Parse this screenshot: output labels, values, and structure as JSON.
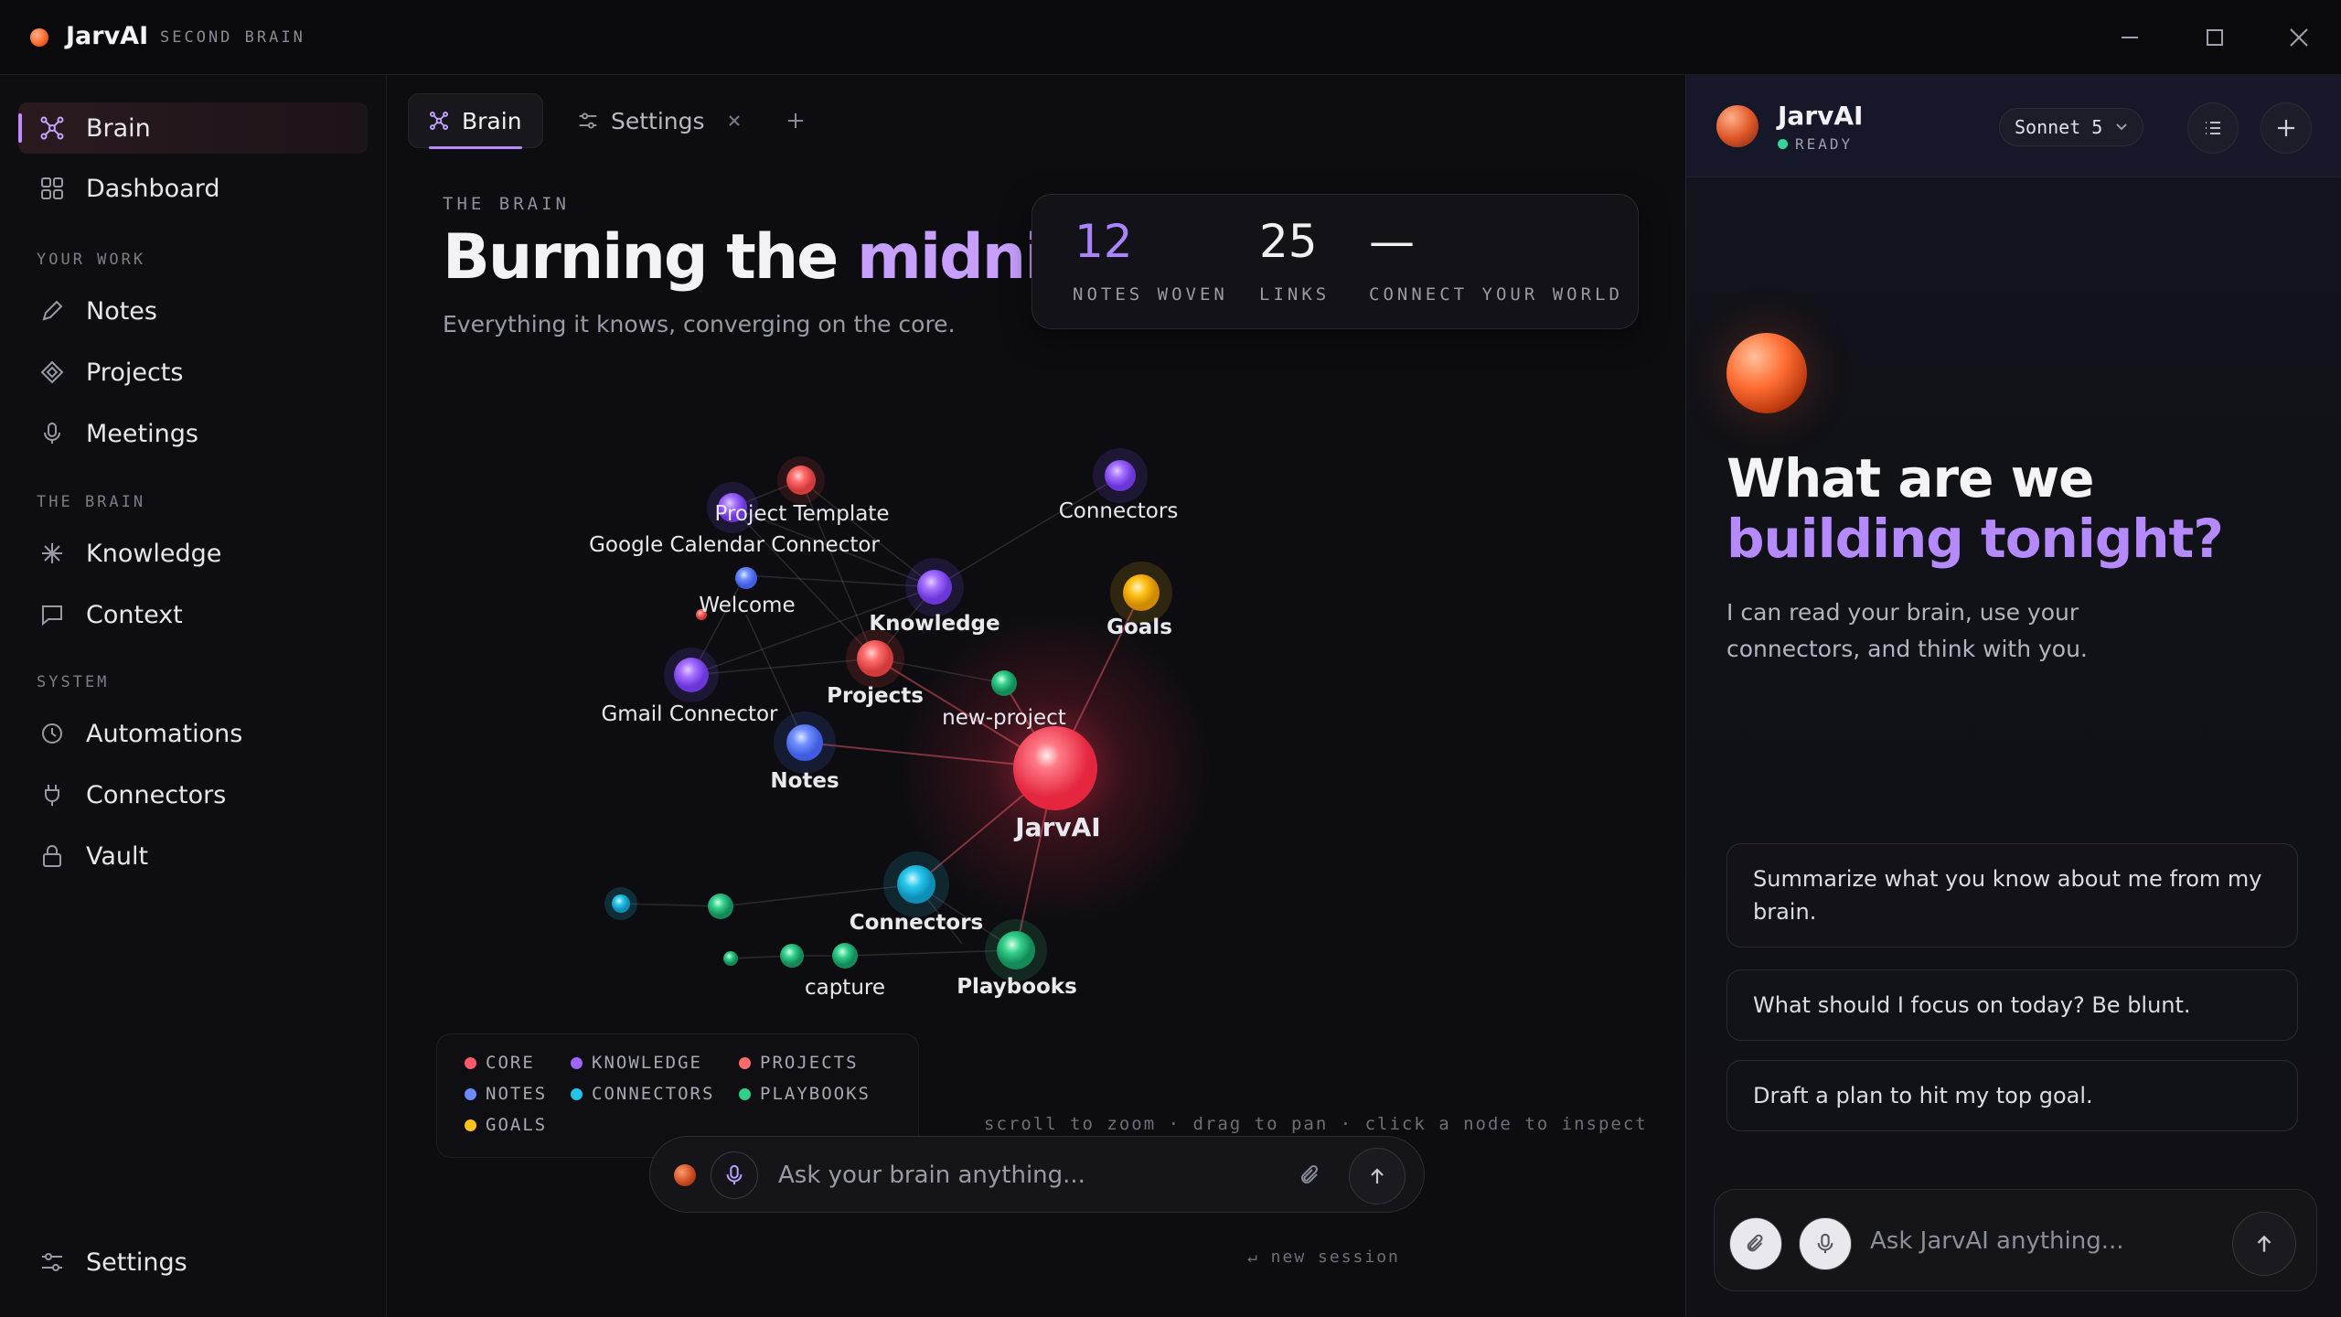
{
  "app": {
    "name": "JarvAI",
    "subtitle": "SECOND BRAIN"
  },
  "sidebar": {
    "items_top": [
      {
        "label": "Brain",
        "icon": "graph-icon",
        "active": true
      },
      {
        "label": "Dashboard",
        "icon": "grid-icon"
      }
    ],
    "section_work": "YOUR WORK",
    "items_work": [
      {
        "label": "Notes",
        "icon": "pencil-icon"
      },
      {
        "label": "Projects",
        "icon": "diamond-icon"
      },
      {
        "label": "Meetings",
        "icon": "mic-icon"
      }
    ],
    "section_brain": "THE BRAIN",
    "items_brain": [
      {
        "label": "Knowledge",
        "icon": "sparkle-icon"
      },
      {
        "label": "Context",
        "icon": "chat-icon"
      }
    ],
    "section_system": "SYSTEM",
    "items_system": [
      {
        "label": "Automations",
        "icon": "clock-icon"
      },
      {
        "label": "Connectors",
        "icon": "plug-icon"
      },
      {
        "label": "Vault",
        "icon": "lock-icon"
      }
    ],
    "settings_label": "Settings"
  },
  "tabs": [
    {
      "label": "Brain",
      "active": true
    },
    {
      "label": "Settings"
    }
  ],
  "main": {
    "eyebrow": "THE BRAIN",
    "headline_a": "Burning the ",
    "headline_b": "midnight oil",
    "subhead": "Everything it knows, converging on the core.",
    "stats": [
      {
        "value": "12",
        "label": "NOTES WOVEN"
      },
      {
        "value": "25",
        "label": "LINKS"
      },
      {
        "value": "—",
        "label": "CONNECT YOUR WORLD"
      }
    ],
    "hint": "scroll to zoom · drag to pan · click a node to inspect",
    "ask_placeholder": "Ask your brain anything...",
    "new_session": "↵ new session"
  },
  "graph": {
    "nodes": [
      {
        "label": "Project Template"
      },
      {
        "label": "Google Calendar Connector"
      },
      {
        "label": "Connectors"
      },
      {
        "label": "Welcome"
      },
      {
        "label": "Knowledge"
      },
      {
        "label": "Goals"
      },
      {
        "label": "Gmail Connector"
      },
      {
        "label": "Projects"
      },
      {
        "label": "new-project"
      },
      {
        "label": "Notes"
      },
      {
        "label": "JarvAI"
      },
      {
        "label": "Connectors"
      },
      {
        "label": "capture"
      },
      {
        "label": "Playbooks"
      }
    ]
  },
  "legend": [
    {
      "label": "CORE",
      "color": "#ff5a6a"
    },
    {
      "label": "KNOWLEDGE",
      "color": "#a064ff"
    },
    {
      "label": "PROJECTS",
      "color": "#ff6b6b"
    },
    {
      "label": "NOTES",
      "color": "#6a8cff"
    },
    {
      "label": "CONNECTORS",
      "color": "#22c5e8"
    },
    {
      "label": "PLAYBOOKS",
      "color": "#2fd08a"
    },
    {
      "label": "GOALS",
      "color": "#ffc21a"
    }
  ],
  "chat": {
    "name": "JarvAI",
    "status": "READY",
    "model": "Sonnet 5",
    "title_a": "What are we",
    "title_b": "building tonight?",
    "desc": "I can read your brain, use your connectors, and think with you.",
    "suggestions": [
      "Summarize what you know about me from my brain.",
      "What should I focus on today? Be blunt.",
      "Draft a plan to hit my top goal."
    ],
    "placeholder": "Ask JarvAI anything..."
  }
}
